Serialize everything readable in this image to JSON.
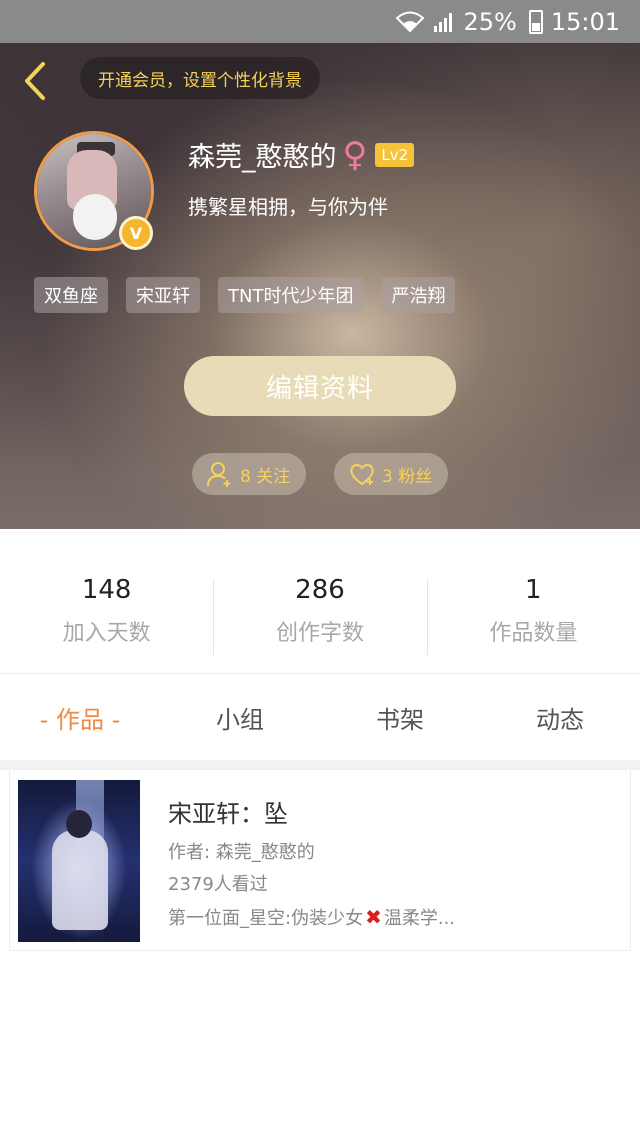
{
  "status_bar": {
    "battery_percent": "25%",
    "time": "15:01"
  },
  "header": {
    "vip_prompt": "开通会员，设置个性化背景"
  },
  "profile": {
    "username": "森莞_憨憨的",
    "gender_symbol": "♀",
    "level": "Lv2",
    "verified_badge": "V",
    "signature": "携繁星相拥，与你为伴",
    "tags": [
      "双鱼座",
      "宋亚轩",
      "TNT时代少年团",
      "严浩翔"
    ],
    "edit_button": "编辑资料",
    "following_label": "8 关注",
    "fans_label": "3 粉丝"
  },
  "stats": [
    {
      "value": "148",
      "label": "加入天数"
    },
    {
      "value": "286",
      "label": "创作字数"
    },
    {
      "value": "1",
      "label": "作品数量"
    }
  ],
  "tabs": [
    {
      "label": "- 作品 -",
      "active": true
    },
    {
      "label": "小组",
      "active": false
    },
    {
      "label": "书架",
      "active": false
    },
    {
      "label": "动态",
      "active": false
    }
  ],
  "works": [
    {
      "title": "宋亚轩：坠",
      "author": "作者: 森莞_憨憨的",
      "views": "2379人看过",
      "desc_part1": "第一位面_星空:伪装少女",
      "desc_mark": "✖",
      "desc_part2": "温柔学..."
    }
  ],
  "colors": {
    "accent": "#f08a42",
    "vip_text": "#f5d25a",
    "edit_button_bg": "#e8dcb8",
    "level_badge": "#f5c23a"
  }
}
